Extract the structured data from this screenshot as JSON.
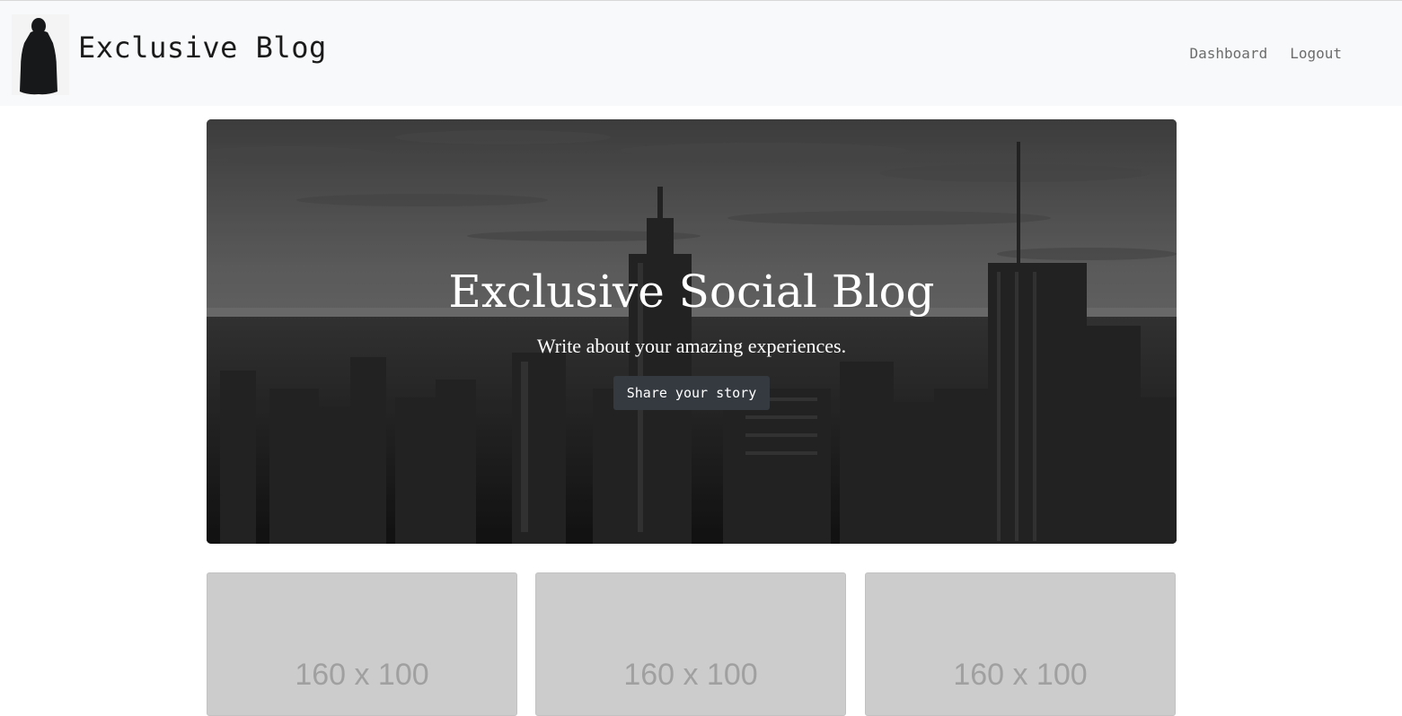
{
  "navbar": {
    "brand": "Exclusive Blog",
    "links": [
      "Dashboard",
      "Logout"
    ]
  },
  "hero": {
    "title": "Exclusive Social Blog",
    "subtitle": "Write about your amazing experiences.",
    "cta_label": "Share your story"
  },
  "cards": [
    {
      "placeholder": "160 x 100"
    },
    {
      "placeholder": "160 x 100"
    },
    {
      "placeholder": "160 x 100"
    }
  ],
  "colors": {
    "navbar_bg": "#f8f9fa",
    "button_bg": "#343a40",
    "placeholder_bg": "#cccccc"
  }
}
